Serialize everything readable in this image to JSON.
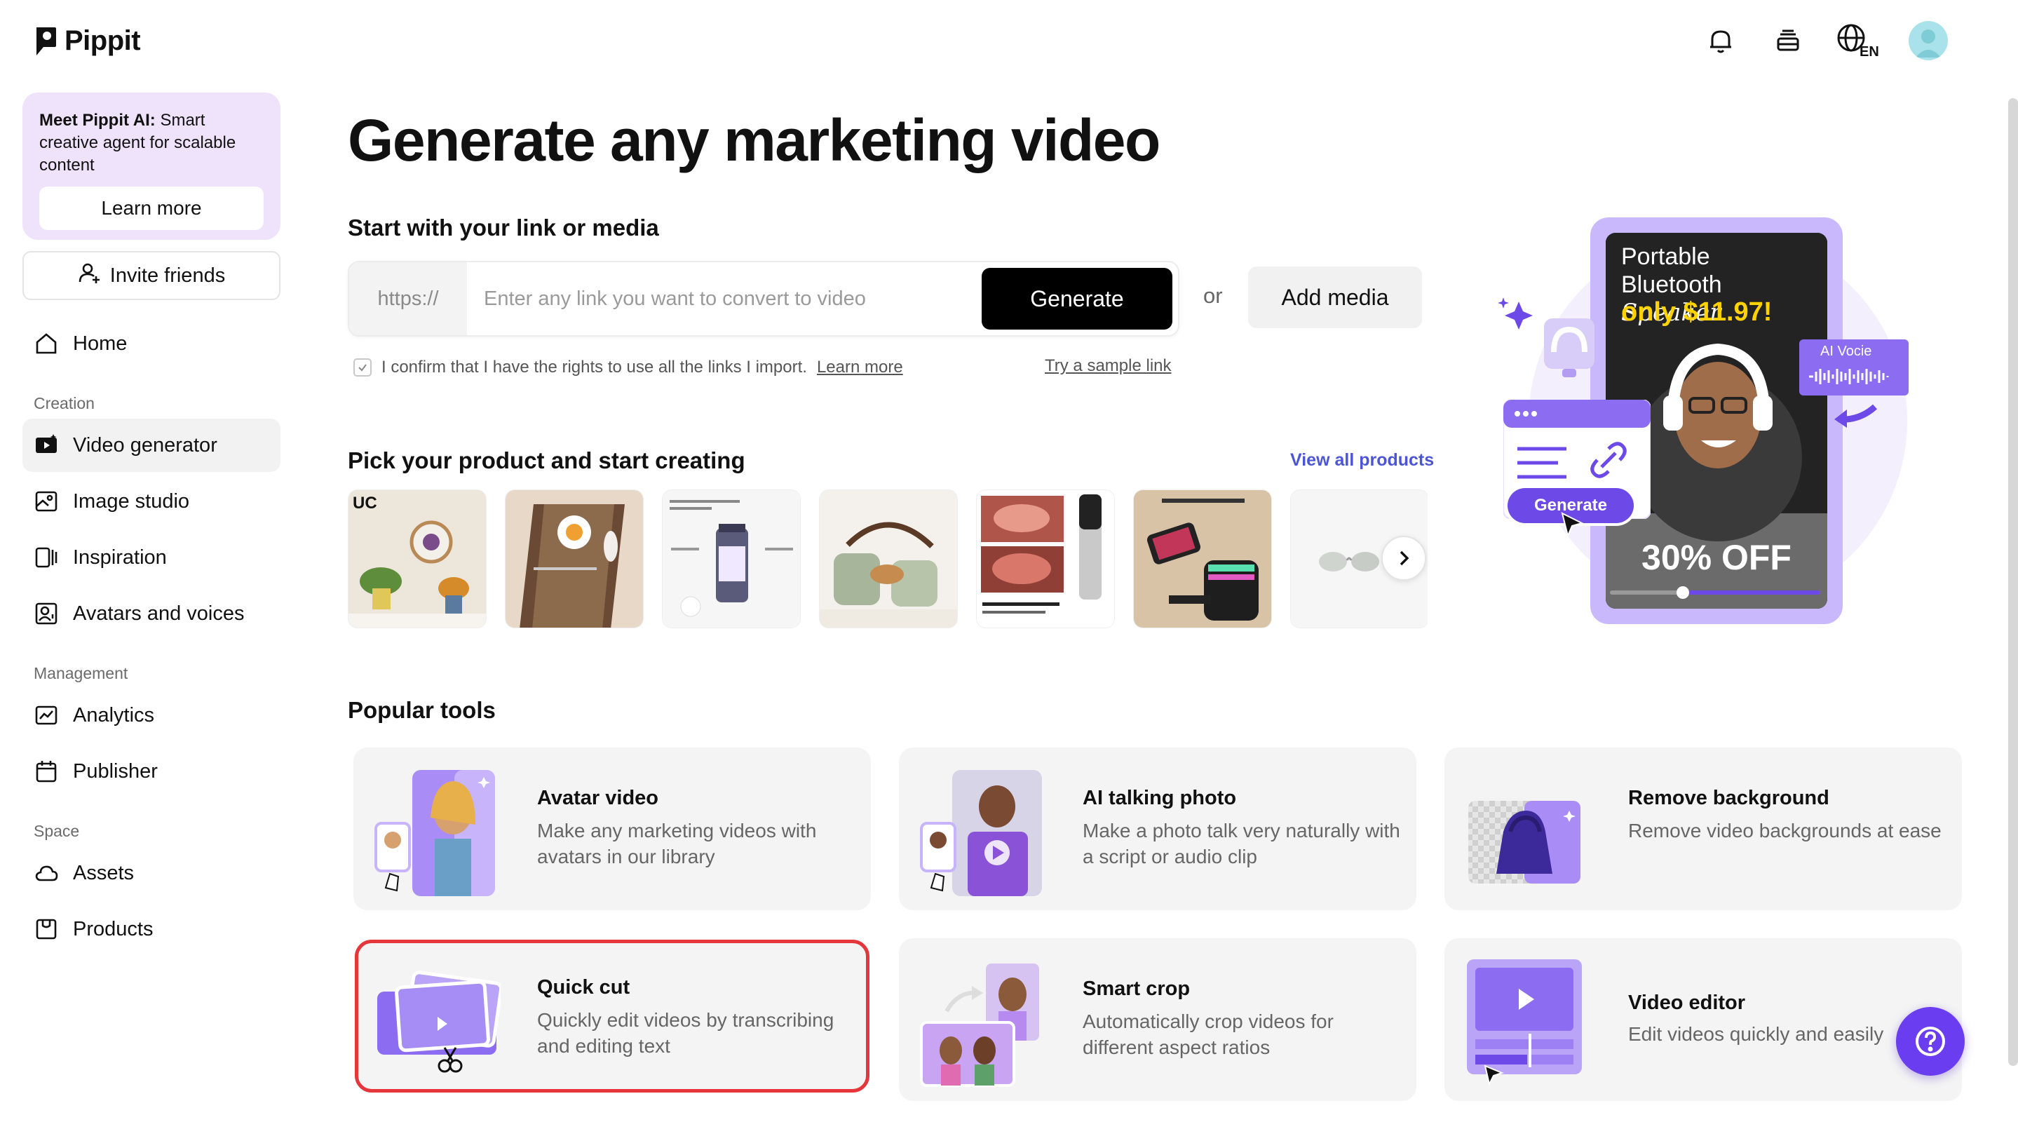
{
  "app": {
    "name": "Pippit"
  },
  "header": {
    "icons": [
      "bell-icon",
      "stack-icon",
      "globe-icon",
      "avatar"
    ],
    "language": "EN"
  },
  "sidebar": {
    "promo": {
      "title_bold": "Meet Pippit AI:",
      "title_rest": " Smart creative agent for scalable content",
      "button": "Learn more"
    },
    "invite": "Invite friends",
    "home": "Home",
    "sections": {
      "creation": "Creation",
      "management": "Management",
      "space": "Space"
    },
    "creation_items": [
      "Video generator",
      "Image studio",
      "Inspiration",
      "Avatars and voices"
    ],
    "management_items": [
      "Analytics",
      "Publisher"
    ],
    "space_items": [
      "Assets",
      "Products"
    ]
  },
  "main": {
    "title": "Generate any marketing video",
    "subtitle": "Start with your link or media",
    "link_prefix": "https://",
    "link_placeholder": "Enter any link you want to convert to video",
    "generate": "Generate",
    "or": "or",
    "add_media": "Add media",
    "confirm_text": "I confirm that I have the rights to use all the links I import.",
    "confirm_link": "Learn more",
    "sample_link": "Try a sample link",
    "pick_title": "Pick your product and start creating",
    "view_all": "View all products",
    "popular_title": "Popular tools",
    "tools": [
      {
        "name": "Avatar video",
        "desc": "Make any marketing videos with avatars in our library"
      },
      {
        "name": "AI talking photo",
        "desc": "Make a photo talk very naturally with a script or audio clip"
      },
      {
        "name": "Remove background",
        "desc": "Remove video backgrounds at ease"
      },
      {
        "name": "Quick cut",
        "desc": "Quickly edit videos by transcribing and editing text"
      },
      {
        "name": "Smart crop",
        "desc": "Automatically crop videos for different aspect ratios"
      },
      {
        "name": "Video editor",
        "desc": "Edit videos quickly and easily"
      }
    ]
  },
  "hero": {
    "line1": "Portable",
    "line2": "Bluetooth",
    "line2_italic": "Speaker",
    "price": "only $11.97!",
    "off": "30% OFF",
    "generate": "Generate",
    "ai_voice": "AI Vocie"
  },
  "colors": {
    "accent": "#6a3df0",
    "highlight": "#e5363b",
    "link": "#4b55d6"
  }
}
